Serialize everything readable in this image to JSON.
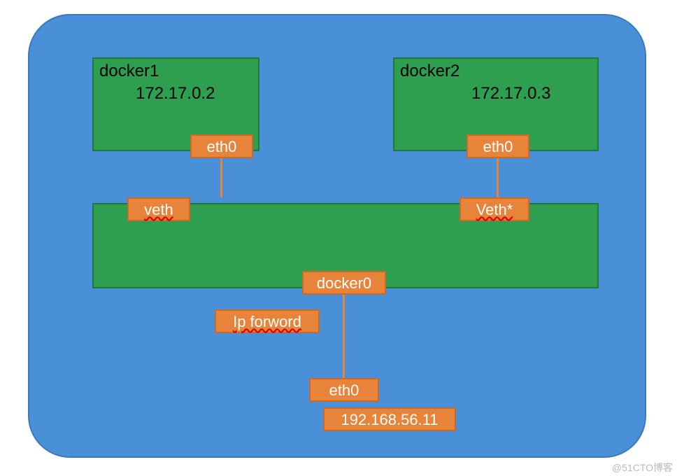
{
  "docker1": {
    "title": "docker1",
    "ip": "172.17.0.2",
    "iface": "eth0",
    "veth": "veth"
  },
  "docker2": {
    "title": "docker2",
    "ip": "172.17.0.3",
    "iface": "eth0",
    "veth": "Veth*"
  },
  "bridge": {
    "iface": "docker0"
  },
  "host": {
    "forward": "Ip forword",
    "iface": "eth0",
    "ip": "192.168.56.11"
  },
  "watermark": "@51CTO博客"
}
